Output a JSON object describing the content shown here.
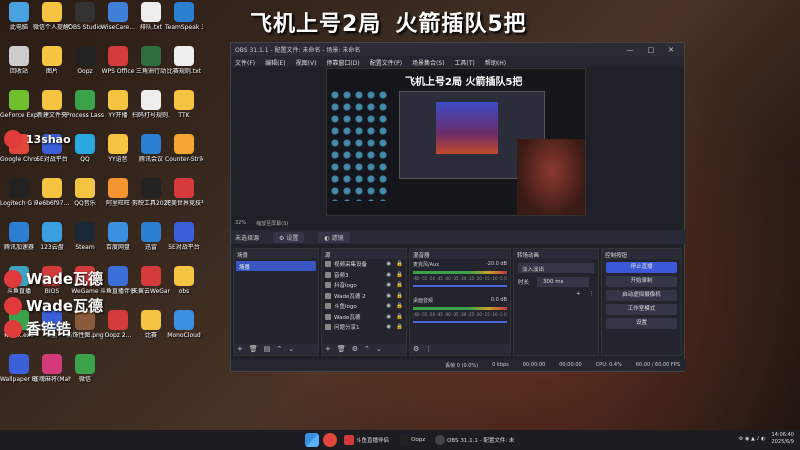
{
  "stream_title": {
    "part1": "飞机上号2局",
    "part2": "火箭插队5把"
  },
  "desktop_icons": [
    {
      "label": "此电脑",
      "color": "#4aa3e0"
    },
    {
      "label": "微信个人提醒工具",
      "color": "#f5c542"
    },
    {
      "label": "OBS Studio",
      "color": "#333333"
    },
    {
      "label": "WiseCare...",
      "color": "#3f7fd8"
    },
    {
      "label": "排队.txt",
      "color": "#eeeeee"
    },
    {
      "label": "TeamSpeak 3",
      "color": "#2a7fd0"
    },
    {
      "label": "回收站",
      "color": "#cccccc"
    },
    {
      "label": "图片",
      "color": "#f5c542"
    },
    {
      "label": "Oopz",
      "color": "#222222"
    },
    {
      "label": "WPS Office",
      "color": "#d43a3a"
    },
    {
      "label": "三角洲行动",
      "color": "#2f6f3f"
    },
    {
      "label": "比赛规则.txt",
      "color": "#eeeeee"
    },
    {
      "label": "GeForce Experience",
      "color": "#6fbf2f"
    },
    {
      "label": "新建文件夹",
      "color": "#f5c542"
    },
    {
      "label": "Process Lasso",
      "color": "#3aa34a"
    },
    {
      "label": "YY开播",
      "color": "#f5c542"
    },
    {
      "label": "扫码打号规则.txt",
      "color": "#eeeeee"
    },
    {
      "label": "TTK",
      "color": "#f5c542"
    },
    {
      "label": "Google Chrome",
      "color": "#e0463a"
    },
    {
      "label": "5E对战平台",
      "color": "#3a5fd8"
    },
    {
      "label": "QQ",
      "color": "#2aa8e0"
    },
    {
      "label": "YY语音",
      "color": "#f5c542"
    },
    {
      "label": "腾讯会议",
      "color": "#2a7fd0"
    },
    {
      "label": "Counter-Strike 2",
      "color": "#f5a532"
    },
    {
      "label": "Logitech G HUB",
      "color": "#222222"
    },
    {
      "label": "7e6b6f97...",
      "color": "#f5c542"
    },
    {
      "label": "QQ音乐",
      "color": "#f5c542"
    },
    {
      "label": "阿里旺旺",
      "color": "#f59532"
    },
    {
      "label": "剪映工具2025 - 快...",
      "color": "#222222"
    },
    {
      "label": "完美世界竞技平台",
      "color": "#d43a3a"
    },
    {
      "label": "腾讯加速器",
      "color": "#2a7fd0"
    },
    {
      "label": "123云盘",
      "color": "#3a9fe0"
    },
    {
      "label": "Steam",
      "color": "#1b2838"
    },
    {
      "label": "百度网盘",
      "color": "#3a8fe0"
    },
    {
      "label": "迅雷",
      "color": "#2a7fd0"
    },
    {
      "label": "5E对战平台",
      "color": "#3a5fd8"
    },
    {
      "label": "斗鱼直播",
      "color": "#3aa3c0"
    },
    {
      "label": "BIOS",
      "color": "#d43a3a"
    },
    {
      "label": "WeGame",
      "color": "#d43a3a"
    },
    {
      "label": "斗鱼直播伴侣",
      "color": "#3a6fd8"
    },
    {
      "label": "天翼云WeGame版",
      "color": "#d43a3a"
    },
    {
      "label": "obs",
      "color": "#f5c542"
    },
    {
      "label": "KOOK.exe",
      "color": "#3aa34a"
    },
    {
      "label": "U盘",
      "color": "#3a5fd8"
    },
    {
      "label": "装饰性图.png",
      "color": "#8a5a3a"
    },
    {
      "label": "Oopz 2...",
      "color": "#d43a3a"
    },
    {
      "label": "比赛",
      "color": "#f5c542"
    },
    {
      "label": "MonoCloud",
      "color": "#3a8fe0"
    },
    {
      "label": "Wallpaper Engine:...",
      "color": "#3a5fd8"
    },
    {
      "label": "雀魂麻将(Mahjong...",
      "color": "#d43a7a"
    },
    {
      "label": "微信",
      "color": "#3aa34a"
    }
  ],
  "overlay_tags": [
    {
      "platform": "斗鱼",
      "name": "13shao",
      "icon": "douyu"
    },
    {
      "platform": "快手",
      "name": "Wade瓦德",
      "icon": "kuaishou"
    },
    {
      "platform": "斗鱼",
      "name": "Wade瓦德",
      "icon": "douyu"
    },
    {
      "platform": "抖音",
      "name": "香锆锆",
      "icon": "tiktok"
    }
  ],
  "obs": {
    "title": "OBS 31.1.1 - 配置文件: 未命名 - 场景: 未命名",
    "menu": [
      "文件(F)",
      "编辑(E)",
      "视图(V)",
      "停靠窗口(D)",
      "配置文件(P)",
      "场景集合(S)",
      "工具(T)",
      "帮助(H)"
    ],
    "zoom": "32%",
    "zoom_hint": "缩放至屏幕(S)",
    "no_source": "未选择源",
    "props_btn": "设置",
    "filters_btn": "滤镜",
    "scenes_header": "场景",
    "scenes": [
      "场景"
    ],
    "sources_header": "源",
    "sources": [
      "视频采集设备",
      "音频3",
      "抖音logo",
      "Wade瓦德 2",
      "斗鱼logo",
      "Wade瓦德",
      "问题分享1"
    ],
    "mixer_header": "混音器",
    "mixer_channels": [
      {
        "name": "麦克风/Aux",
        "db": "-20.0 dB"
      },
      {
        "name": "桌面音频",
        "db": "0.0 dB"
      }
    ],
    "mixer_scale": "-60 -55 -50 -45 -40 -35 -30 -25 -20 -15 -10 -5 0",
    "transitions_header": "转场动画",
    "transition_type": "淡入淡出",
    "duration_label": "时长",
    "duration_value": "300 ms",
    "controls_header": "控制按钮",
    "controls": [
      "停止直播",
      "开始录制",
      "启动虚拟摄像机",
      "工作室模式",
      "设置"
    ],
    "status": {
      "dropped": "丢帧 0 (0.0%)",
      "bitrate": "0 kbps",
      "stream_time": "00:00:00",
      "rec_time": "00:00:00",
      "cpu": "CPU: 0.4%",
      "fps": "60.00 / 60.00 FPS"
    }
  },
  "taskbar": {
    "apps": [
      {
        "label": "斗鱼直播伴侣",
        "color": "#d43a3a"
      },
      {
        "label": "Oopz",
        "color": "#222222"
      },
      {
        "label": "OBS 31.1.1 - 配置文件: 未",
        "color": "#444444"
      }
    ],
    "time": "14:06:40",
    "date": "2025/6/9"
  }
}
